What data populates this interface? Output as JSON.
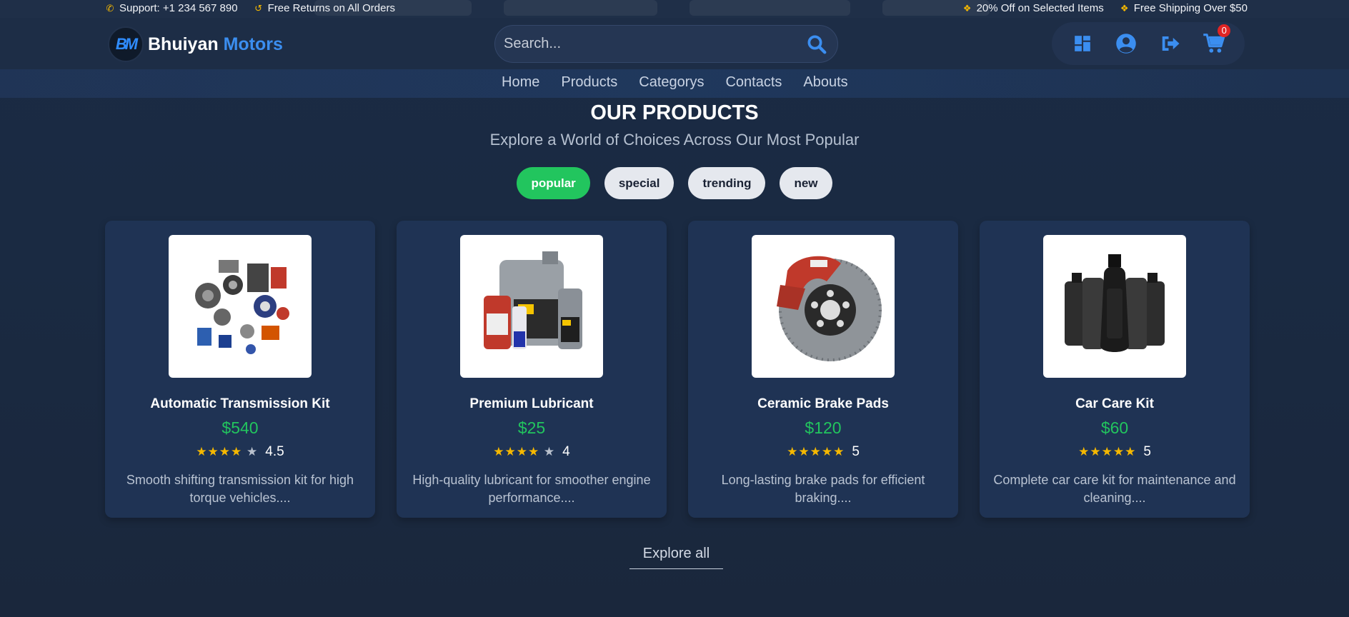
{
  "topbar": {
    "support": "Support: +1 234 567 890",
    "returns": "Free Returns on All Orders",
    "discount": "20% Off on Selected Items",
    "shipping": "Free Shipping Over $50"
  },
  "brand": {
    "name": "Bhuiyan",
    "accent": "Motors",
    "badge": "BM"
  },
  "search": {
    "placeholder": "Search..."
  },
  "cart": {
    "count": "0"
  },
  "nav": [
    "Home",
    "Products",
    "Categorys",
    "Contacts",
    "Abouts"
  ],
  "section": {
    "title": "OUR PRODUCTS",
    "subtitle": "Explore a World of Choices Across Our Most Popular"
  },
  "tabs": [
    "popular",
    "special",
    "trending",
    "new"
  ],
  "active_tab": "popular",
  "products": [
    {
      "name": "Automatic Transmission Kit",
      "price": "$540",
      "rating": "4.5",
      "stars": 4,
      "description": "Smooth shifting transmission kit for high torque vehicles....",
      "image": "transmission-parts-image"
    },
    {
      "name": "Premium Lubricant",
      "price": "$25",
      "rating": "4",
      "stars": 4,
      "description": "High-quality lubricant for smoother engine performance....",
      "image": "lubricant-bottles-image"
    },
    {
      "name": "Ceramic Brake Pads",
      "price": "$120",
      "rating": "5",
      "stars": 5,
      "description": "Long-lasting brake pads for efficient braking....",
      "image": "brake-disc-image"
    },
    {
      "name": "Car Care Kit",
      "price": "$60",
      "rating": "5",
      "stars": 5,
      "description": "Complete car care kit for maintenance and cleaning....",
      "image": "car-care-bottles-image"
    }
  ],
  "explore_label": "Explore all",
  "colors": {
    "accent": "#3b8ef0",
    "price": "#22c55e",
    "star": "#f5b800",
    "badge": "#e02424"
  }
}
